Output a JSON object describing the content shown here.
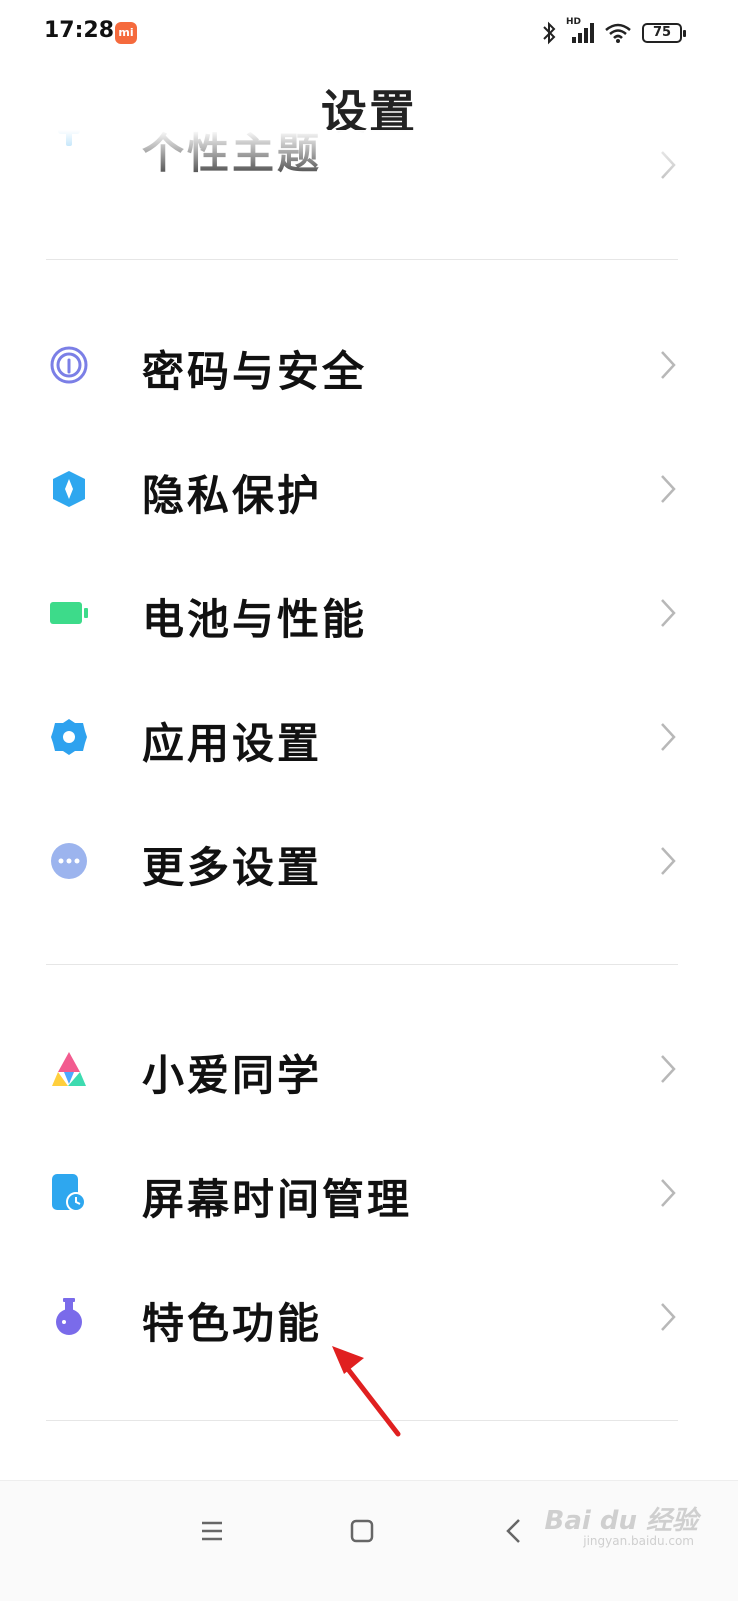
{
  "status_bar": {
    "time": "17:28",
    "mi_badge": "mi",
    "network_label": "HD",
    "battery": "75"
  },
  "header": {
    "title": "设置"
  },
  "partial_item": {
    "label": "个性主题",
    "icon": "theme-icon"
  },
  "groups": [
    {
      "items": [
        {
          "label": "密码与安全",
          "icon": "fingerprint-icon",
          "color": "#7b7fe6"
        },
        {
          "label": "隐私保护",
          "icon": "privacy-shield-icon",
          "color": "#2ea7ef"
        },
        {
          "label": "电池与性能",
          "icon": "battery-icon",
          "color": "#3ddb8a"
        },
        {
          "label": "应用设置",
          "icon": "gear-icon",
          "color": "#2ea2ef"
        },
        {
          "label": "更多设置",
          "icon": "more-dots-icon",
          "color": "#9cb4ee"
        }
      ]
    },
    {
      "items": [
        {
          "label": "小爱同学",
          "icon": "xiaoai-icon",
          "color": "#f25b8f"
        },
        {
          "label": "屏幕时间管理",
          "icon": "screen-time-icon",
          "color": "#2ea7ef"
        },
        {
          "label": "特色功能",
          "icon": "flask-icon",
          "color": "#7a6bea"
        }
      ]
    }
  ],
  "watermark": {
    "text": "Bai du 经验",
    "sub": "jingyan.baidu.com"
  },
  "colors": {
    "annotation_arrow": "#e02020",
    "chevron": "#b8b8b8"
  }
}
